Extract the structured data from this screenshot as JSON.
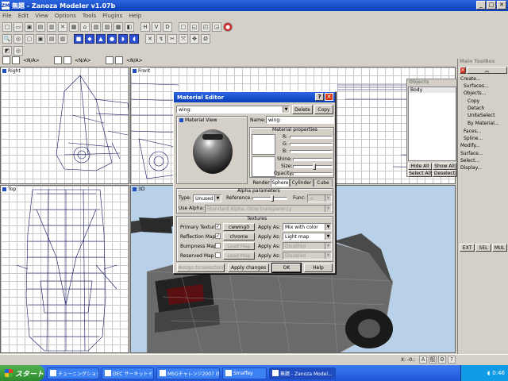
{
  "window": {
    "title": "無題 - Zanoza Modeler v1.07b",
    "icon_text": "ZM"
  },
  "menu": [
    "File",
    "Edit",
    "View",
    "Options",
    "Tools",
    "Plugins",
    "Help"
  ],
  "toolbar1_glyphs": [
    "□",
    "▭",
    "▣",
    "▤",
    "▥",
    "✕",
    "▦",
    "⌂",
    "▧",
    "▨",
    "▩",
    "◧",
    "H",
    "V",
    "D",
    "□",
    "◱",
    "◰",
    "◲",
    "●"
  ],
  "toolbar2_glyphs": [
    "🔍",
    "◎",
    "▢",
    "▣",
    "▤",
    "▥",
    "■",
    "◆",
    "▲",
    "●",
    "◗",
    "◖",
    "✕",
    "↯",
    "✂",
    "⤧",
    "✥",
    "Ø"
  ],
  "view_selectors": [
    {
      "label": "<N/A>"
    },
    {
      "label": "<N/A>"
    },
    {
      "label": "<N/A>"
    }
  ],
  "viewports": {
    "right": "Right",
    "front": "Front",
    "top": "Top",
    "perspective": "3D"
  },
  "material_editor": {
    "title": "Material Editor",
    "material_name": "wing:",
    "delete_label": "Delete",
    "copy_label": "Copy",
    "material_view_label": "Material View",
    "name_label": "Name:",
    "name_value": "wing:",
    "properties_title": "Material properties",
    "rgb_labels": [
      "R:",
      "G:",
      "B:"
    ],
    "shine_label": "Shine:",
    "size_label": "Size:",
    "opacity_label": "Opacity:",
    "preview_tabs": [
      "Render",
      "Sphere",
      "Cylinder",
      "Cube"
    ],
    "active_preview_tab": "Sphere",
    "alpha": {
      "title": "Alpha parameters",
      "type_label": "Type:",
      "type_value": "Unused",
      "reference_label": "Reference:",
      "func_label": "Func:",
      "func_value": "<",
      "use_alpha_label": "Use Alpha:",
      "use_alpha_value": "Standard Alpha, Glow transparency"
    },
    "textures": {
      "title": "Textures",
      "apply_label": "Apply As:",
      "rows": [
        {
          "label": "Primary Texture",
          "checked": true,
          "map": "cwwing0",
          "apply": "Mix with color",
          "enabled": true
        },
        {
          "label": "Reflection Map",
          "checked": true,
          "map": "chrome",
          "apply": "Light map",
          "enabled": true
        },
        {
          "label": "Bumpness Map",
          "checked": false,
          "map": "Load Map",
          "apply": "Disabled",
          "enabled": false
        },
        {
          "label": "Reserved Map",
          "checked": false,
          "map": "Load Map",
          "apply": "Disabled",
          "enabled": false
        }
      ]
    },
    "assign_label": "Assign to selection",
    "apply_changes_label": "Apply changes",
    "ok_label": "OK",
    "help_label": "Help"
  },
  "objects_panel": {
    "title": "Objects",
    "items": [
      "Body"
    ],
    "hide_all": "Hide All",
    "show_all": "Show All",
    "select_all": "Select All",
    "deselect": "Deselect"
  },
  "toolbox": {
    "title": "Main ToolBox",
    "items": [
      "Create...",
      "Surfaces...",
      "Objects...",
      "Copy",
      "Detach",
      "UniteSelect",
      "By Material...",
      "Faces...",
      "Spline...",
      "Modify...",
      "Surface...",
      "Select...",
      "Display..."
    ],
    "bottom_buttons": [
      "EXT",
      "SEL",
      "MUL"
    ]
  },
  "status": {
    "coord": "X: -0.:"
  },
  "taskbar": {
    "start_label": "スタート",
    "tasks": [
      "チューニングショップ  カ...",
      "DEC サーキットイベント...",
      "MSGチャレンジ2007 (終...",
      "Smaffey",
      "無題 - Zanoza Model..."
    ],
    "active_task": 4,
    "clock": "0:46"
  },
  "colors": {
    "title_blue": "#0a3fba",
    "viewport_sky": "#b8d0e8",
    "wireframe": "#101060"
  }
}
